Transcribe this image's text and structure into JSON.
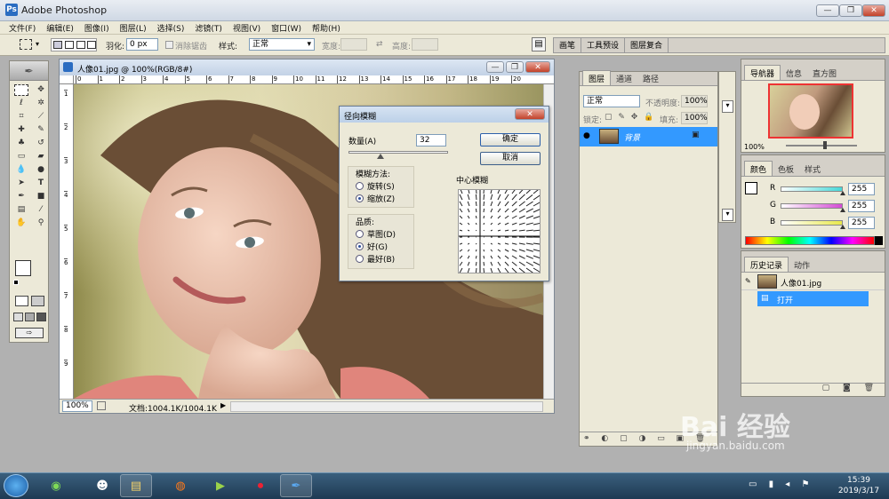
{
  "app": {
    "title": "Adobe Photoshop"
  },
  "window_controls": {
    "minimize": "—",
    "restore": "❐",
    "close": "✕"
  },
  "menu": [
    "文件(F)",
    "编辑(E)",
    "图像(I)",
    "图层(L)",
    "选择(S)",
    "滤镜(T)",
    "视图(V)",
    "窗口(W)",
    "帮助(H)"
  ],
  "options_bar": {
    "feather_label": "羽化:",
    "feather_value": "0 px",
    "antialias_label": "消除锯齿",
    "style_label": "样式:",
    "style_value": "正常",
    "width_label": "宽度:",
    "height_label": "高度:"
  },
  "panel_well_tabs": [
    "画笔",
    "工具预设",
    "图层复合"
  ],
  "document": {
    "title": "人像01.jpg @ 100%(RGB/8#)",
    "zoom": "100%",
    "doc_info": "文档:1004.1K/1004.1K",
    "ruler_h": [
      "0",
      "1",
      "2",
      "3",
      "4",
      "5",
      "6",
      "7",
      "8",
      "9",
      "10",
      "11",
      "12",
      "13",
      "14",
      "15",
      "16",
      "17",
      "18",
      "19",
      "20"
    ],
    "ruler_v": [
      "1",
      "2",
      "3",
      "4",
      "5",
      "6",
      "7",
      "8",
      "9"
    ]
  },
  "dialog": {
    "title": "径向模糊",
    "amount_label": "数量(A)",
    "amount_value": "32",
    "amount_fraction": 0.32,
    "ok": "确定",
    "cancel": "取消",
    "method_label": "模糊方法:",
    "methods": [
      {
        "label": "旋转(S)",
        "checked": false
      },
      {
        "label": "缩放(Z)",
        "checked": true
      }
    ],
    "quality_label": "品质:",
    "qualities": [
      {
        "label": "草图(D)",
        "checked": false
      },
      {
        "label": "好(G)",
        "checked": true
      },
      {
        "label": "最好(B)",
        "checked": false
      }
    ],
    "center_label": "中心模糊"
  },
  "layers_panel": {
    "tabs": [
      "图层",
      "通道",
      "路径"
    ],
    "blend_mode": "正常",
    "opacity_label": "不透明度:",
    "opacity_value": "100%",
    "lock_label": "锁定:",
    "fill_label": "填充:",
    "fill_value": "100%",
    "layer_name": "背景"
  },
  "navigator_panel": {
    "tabs": [
      "导航器",
      "信息",
      "直方图"
    ],
    "zoom": "100%"
  },
  "color_panel": {
    "tabs": [
      "颜色",
      "色板",
      "样式"
    ],
    "channels": [
      {
        "label": "R",
        "value": "255",
        "color": "#46d8d8"
      },
      {
        "label": "G",
        "value": "255",
        "color": "#d44bd4"
      },
      {
        "label": "B",
        "value": "255",
        "color": "#e8e84a"
      }
    ]
  },
  "history_panel": {
    "tabs": [
      "历史记录",
      "动作"
    ],
    "snapshot": "人像01.jpg",
    "step": "打开"
  },
  "watermark": {
    "brand": "Bai 经验",
    "url": "jingyan.baidu.com"
  },
  "taskbar": {
    "time": "15:39",
    "date": "2019/3/17"
  },
  "colors": {
    "accent": "#3399ff",
    "selection": "#3f8fe8",
    "titlebar": "#cfd8e4"
  }
}
